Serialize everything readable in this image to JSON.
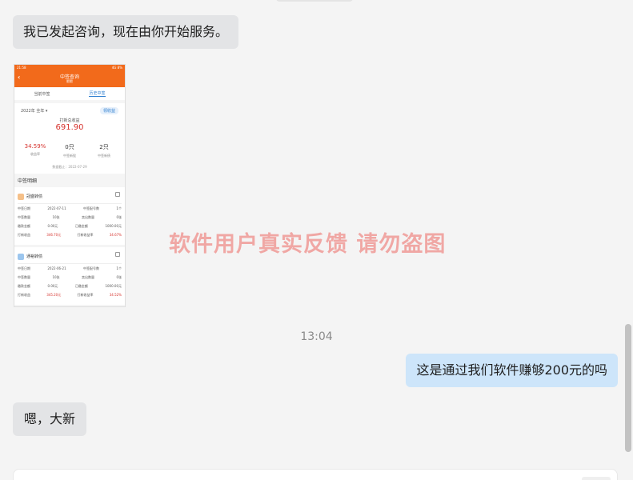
{
  "messages": {
    "system_started": "我已发起咨询，现在由你开始服务。",
    "timestamp": "13:04",
    "user_question": "这是通过我们软件赚够200元的吗",
    "reply": "嗯，大新"
  },
  "watermark": "软件用户真实反馈  请勿盗图",
  "phone": {
    "status_left": "21:58",
    "status_right": "4G 8%",
    "title": "中签查询",
    "subtitle": "肥肥",
    "tabs": [
      "当前中签",
      "历史中签"
    ],
    "year": "2022年 全年 ▾",
    "action_btn": "领收益",
    "total_label": "打新总收益",
    "total": "691.90",
    "stats": [
      {
        "value": "34.59%",
        "label": "收益率"
      },
      {
        "value": "0只",
        "label": "中签新股"
      },
      {
        "value": "2只",
        "label": "中签新债"
      }
    ],
    "date_note": "数据截止：2022-07-29",
    "section": "中签明细",
    "items": [
      {
        "name": "冠盛转债",
        "rows": [
          [
            "中签日期",
            "2022-07-11",
            "中签配号数",
            "1个"
          ],
          [
            "中签数量",
            "10张",
            "卖出数量",
            "0张"
          ],
          [
            "缴款金额",
            "0.00元",
            "已缴金额",
            "1000.00元"
          ],
          [
            "打新收益",
            "346.70元",
            "打新收益率",
            "34.67%"
          ]
        ]
      },
      {
        "name": "通裕转债",
        "rows": [
          [
            "中签日期",
            "2022-06-21",
            "中签配号数",
            "1个"
          ],
          [
            "中签数量",
            "10张",
            "卖出数量",
            "0张"
          ],
          [
            "缴款金额",
            "0.00元",
            "已缴金额",
            "1000.00元"
          ],
          [
            "打新收益",
            "345.20元",
            "打新收益率",
            "34.52%"
          ]
        ]
      }
    ]
  },
  "colors": {
    "accent": "#f26a1b",
    "user_bubble": "#cde5fa",
    "agent_bubble": "#e3e4e6",
    "watermark": "#f0a7a4"
  }
}
